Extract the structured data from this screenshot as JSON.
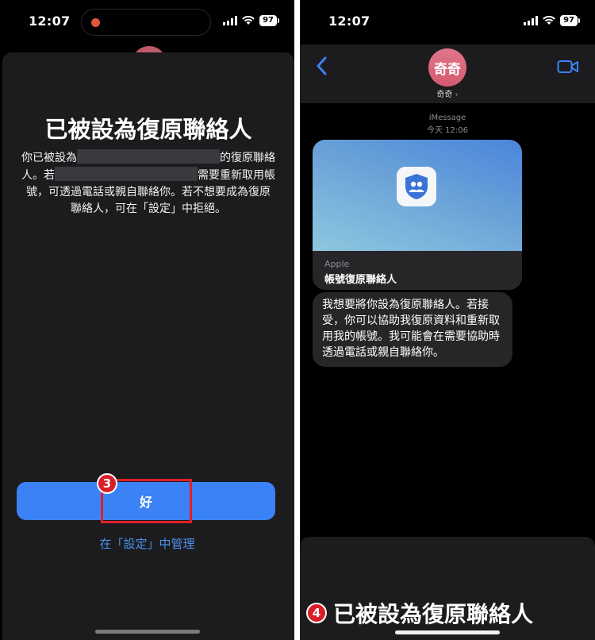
{
  "left": {
    "status_time": "12:07",
    "battery": "97",
    "title": "已被設為復原聯絡人",
    "body_part1": "你已被設為",
    "body_part2": "的復原聯絡人。若",
    "body_part3": "需要重新取用帳號，可透過電話或親自聯絡你。若不想要成為復原聯絡人，可在「設定」中拒絕。",
    "ok_label": "好",
    "manage_link": "在「設定」中管理",
    "step_badge": "3"
  },
  "right": {
    "status_time": "12:07",
    "battery": "97",
    "contact_initials": "奇奇",
    "contact_name": "奇奇",
    "service": "iMessage",
    "timestamp": "今天 12:06",
    "link_source": "Apple",
    "link_title": "帳號復原聯絡人",
    "message": "我想要將你設為復原聯絡人。若接受，你可以協助我復原資料和重新取用我的帳號。我可能會在需要協助時透過電話或親自聯絡你。",
    "caption": "已被設為復原聯絡人",
    "step_badge": "4"
  },
  "colors": {
    "accent_blue": "#3b82f6",
    "link_blue": "#4a90f0",
    "highlight_red": "#e0202a",
    "sheet_bg": "#1c1c1e",
    "bubble_bg": "#262628"
  }
}
